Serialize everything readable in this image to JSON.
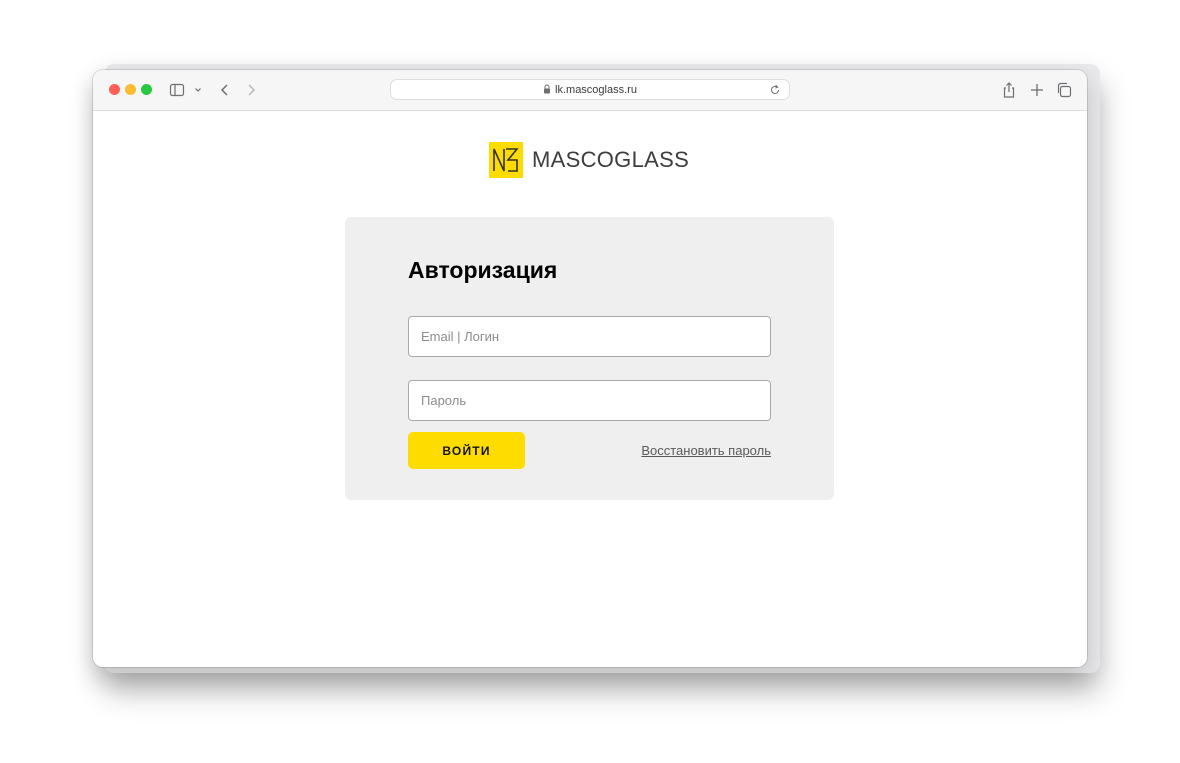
{
  "browser": {
    "url": "lk.mascoglass.ru",
    "icons": [
      "sidebar-icon",
      "chevron-down-icon",
      "back-icon",
      "forward-icon",
      "lock-icon",
      "reload-icon",
      "share-icon",
      "plus-icon",
      "tabs-overview-icon"
    ]
  },
  "brand": {
    "name": "MASCOGLASS",
    "accent": "#ffdc00"
  },
  "login": {
    "title": "Авторизация",
    "login_placeholder": "Email | Логин",
    "login_value": "",
    "password_placeholder": "Пароль",
    "password_value": "",
    "submit_label": "ВОЙТИ",
    "restore_label": "Восстановить пароль"
  }
}
